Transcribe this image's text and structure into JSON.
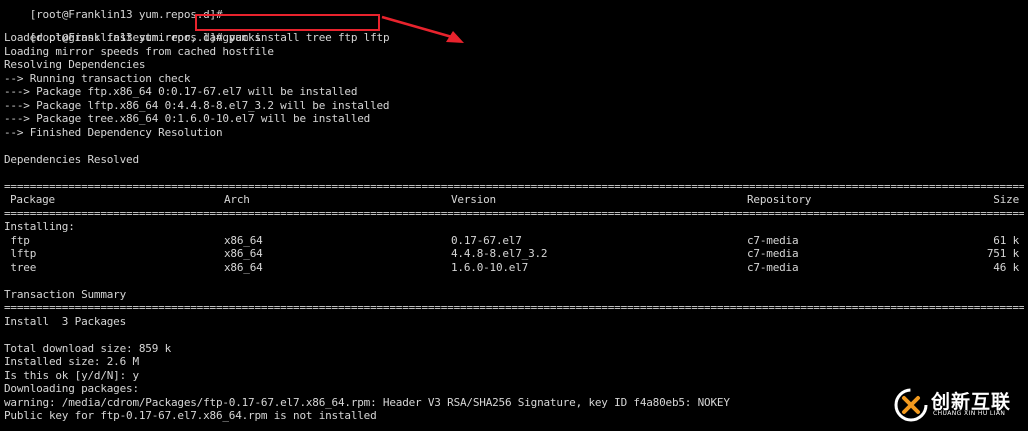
{
  "terminal": {
    "prompt_prev": "[root@Franklin13 yum.repos.d]#",
    "prompt": "[root@Franklin13 yum.repos.d]#",
    "command": " yum install tree ftp lftp",
    "output_lines": [
      "Loaded plugins: fastestmirror, langpacks",
      "Loading mirror speeds from cached hostfile",
      "Resolving Dependencies",
      "--> Running transaction check",
      "---> Package ftp.x86_64 0:0.17-67.el7 will be installed",
      "---> Package lftp.x86_64 0:4.4.8-8.el7_3.2 will be installed",
      "---> Package tree.x86_64 0:1.6.0-10.el7 will be installed",
      "--> Finished Dependency Resolution",
      "",
      "Dependencies Resolved"
    ],
    "table": {
      "headers": [
        "Package",
        "Arch",
        "Version",
        "Repository",
        "Size"
      ],
      "section": "Installing:",
      "rows": [
        [
          " ftp",
          "x86_64",
          "0.17-67.el7",
          "c7-media",
          "61 k"
        ],
        [
          " lftp",
          "x86_64",
          "4.4.8-8.el7_3.2",
          "c7-media",
          "751 k"
        ],
        [
          " tree",
          "x86_64",
          "1.6.0-10.el7",
          "c7-media",
          "46 k"
        ]
      ]
    },
    "summary_title": "Transaction Summary",
    "install_summary": "Install  3 Packages",
    "tail_lines": [
      "Total download size: 859 k",
      "Installed size: 2.6 M",
      "Is this ok [y/d/N]: y",
      "Downloading packages:",
      "warning: /media/cdrom/Packages/ftp-0.17-67.el7.x86_64.rpm: Header V3 RSA/SHA256 Signature, key ID f4a80eb5: NOKEY",
      "Public key for ftp-0.17-67.el7.x86_64.rpm is not installed"
    ]
  },
  "watermark": {
    "name_cn": "创新互联",
    "name_en": "CHUANG XIN HU LIAN"
  },
  "colors": {
    "background": "#000000",
    "text": "#d6d6d6",
    "highlight": "#e8232d",
    "logo_accent": "#f39a1e"
  }
}
